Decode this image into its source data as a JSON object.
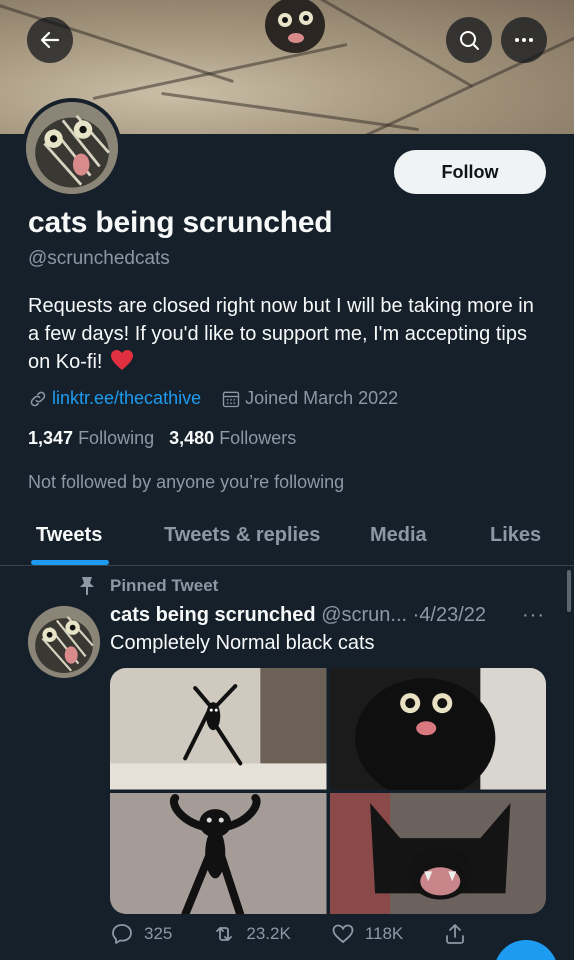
{
  "header": {
    "back_icon": "arrow-left-icon",
    "search_icon": "search-icon",
    "more_icon": "more-dots-icon"
  },
  "profile": {
    "follow_label": "Follow",
    "name": "cats being scrunched",
    "handle": "@scrunchedcats",
    "bio": "Requests are closed right now but I will be taking more in a few days! If you'd like to support me, I'm accepting tips on Ko-fi!",
    "bio_emoji": "heart-icon",
    "link": "linktr.ee/thecathive",
    "joined": "Joined March 2022",
    "following_count": "1,347",
    "following_label": "Following",
    "followers_count": "3,480",
    "followers_label": "Followers",
    "not_followed_text": "Not followed by anyone you’re following"
  },
  "tabs": [
    {
      "label": "Tweets",
      "active": true
    },
    {
      "label": "Tweets & replies",
      "active": false
    },
    {
      "label": "Media",
      "active": false
    },
    {
      "label": "Likes",
      "active": false
    }
  ],
  "tweet": {
    "pinned_label": "Pinned Tweet",
    "name": "cats being scrunched",
    "handle_truncated": "@scrun...",
    "separator": "·",
    "date": "4/23/22",
    "more": "···",
    "text": "Completely Normal black cats",
    "replies": "325",
    "retweets": "23.2K",
    "likes": "118K"
  },
  "colors": {
    "background": "#15202b",
    "accent": "#1d9bf0",
    "secondary_text": "#8b98a5",
    "divider": "#38444d"
  }
}
